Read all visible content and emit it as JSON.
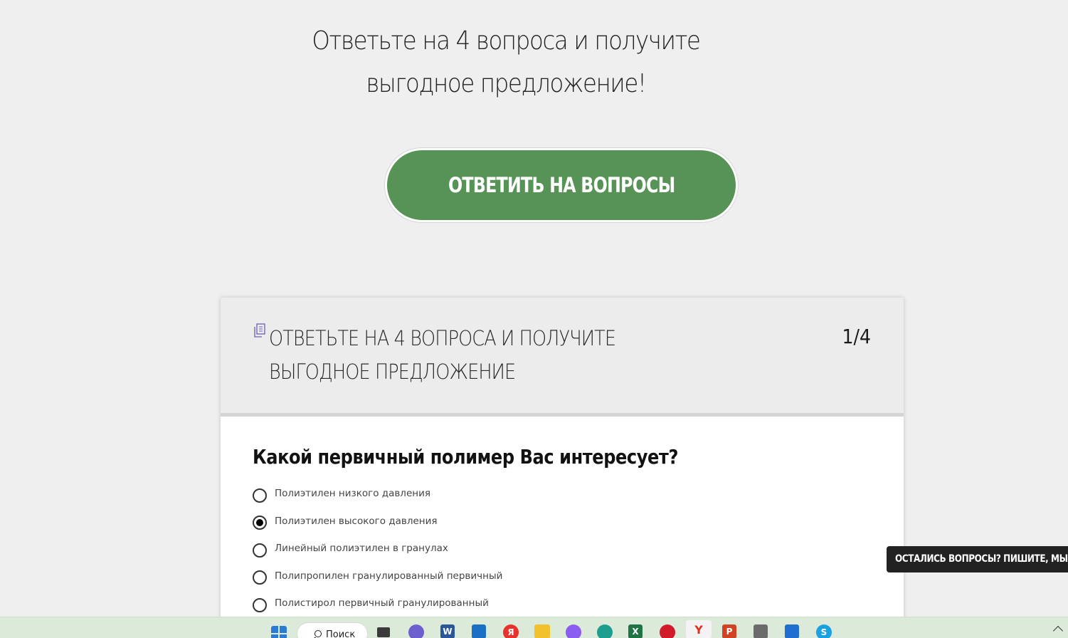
{
  "hero": {
    "line1": "Ответьте на 4 вопроса и получите",
    "line2": "выгодное предложение!",
    "cta_label": "ОТВЕТИТЬ НА ВОПРОСЫ"
  },
  "quiz": {
    "title": "ОТВЕТЬТЕ НА 4 ВОПРОСА И ПОЛУЧИТЕ ВЫГОДНОЕ ПРЕДЛОЖЕНИЕ",
    "counter": "1/4",
    "question": "Какой первичный полимер Вас интересует?",
    "options": [
      {
        "label": "Полиэтилен низкого давления",
        "checked": false
      },
      {
        "label": "Полиэтилен высокого давления",
        "checked": true
      },
      {
        "label": "Линейный полиэтилен в гранулах",
        "checked": false
      },
      {
        "label": "Полипропилен гранулированный первичный",
        "checked": false
      },
      {
        "label": "Полистирол первичный гранулированный",
        "checked": false
      }
    ]
  },
  "chat": {
    "label": "ОСТАЛИСЬ ВОПРОСЫ? ПИШИТЕ, МЫ О"
  },
  "taskbar": {
    "search_label": "Поиск",
    "colors": {
      "accent_green": "#579356",
      "taskbar_bg": "#dcebd9"
    },
    "apps": [
      {
        "icon": "windows-start-icon",
        "glyph": ""
      },
      {
        "icon": "task-view-icon",
        "glyph": ""
      },
      {
        "icon": "teams-chat-icon",
        "glyph": ""
      },
      {
        "icon": "word-icon",
        "glyph": "W"
      },
      {
        "icon": "store-icon",
        "glyph": ""
      },
      {
        "icon": "yandex-icon",
        "glyph": "Я"
      },
      {
        "icon": "file-explorer-icon",
        "glyph": ""
      },
      {
        "icon": "alice-icon",
        "glyph": ""
      },
      {
        "icon": "edge-icon",
        "glyph": ""
      },
      {
        "icon": "excel-icon",
        "glyph": "X"
      },
      {
        "icon": "opera-icon",
        "glyph": ""
      },
      {
        "icon": "yandex-browser-icon",
        "glyph": "Y"
      },
      {
        "icon": "powerpoint-icon",
        "glyph": "P"
      },
      {
        "icon": "calculator-icon",
        "glyph": ""
      },
      {
        "icon": "app-icon",
        "glyph": ""
      },
      {
        "icon": "skype-icon",
        "glyph": "S"
      }
    ]
  }
}
